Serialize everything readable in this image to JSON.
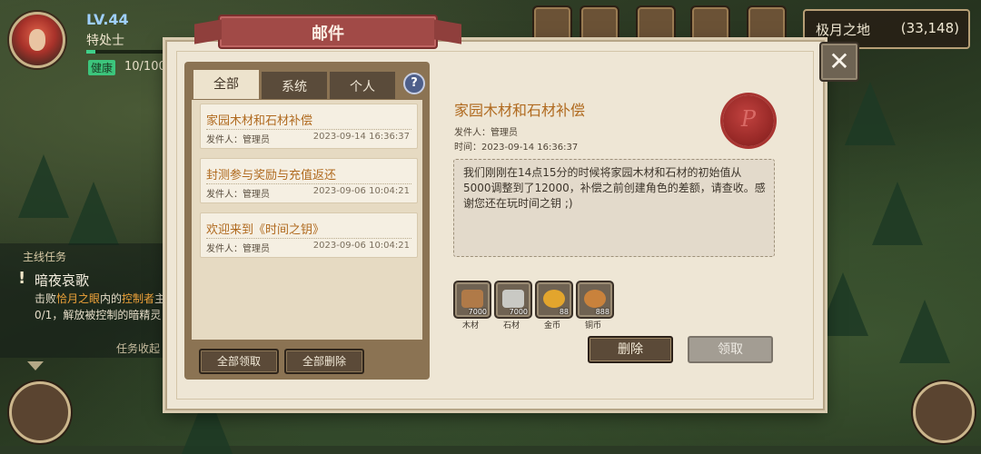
{
  "hud": {
    "level": "LV.44",
    "rank": "特处士",
    "health_label": "健康",
    "health_value": "10/100",
    "health_fraction": 0.1,
    "location_name": "极月之地",
    "location_coords": "(33,148)"
  },
  "quest": {
    "section_title": "主线任务",
    "name": "暗夜哀歌",
    "desc_pre": "击败",
    "desc_hl1": "恰月之眼",
    "desc_mid": "内的",
    "desc_hl2": "控制者",
    "desc_post": "主0/1，解放被控制的暗精灵",
    "collapse_label": "任务收起"
  },
  "dialog": {
    "title": "邮件",
    "close_glyph": "✕",
    "tabs": [
      "全部",
      "系统",
      "个人"
    ],
    "help_glyph": "?",
    "mails": [
      {
        "subject": "家园木材和石材补偿",
        "from": "发件人：管理员",
        "date": "2023-09-14 16:36:37"
      },
      {
        "subject": "封测参与奖励与充值返还",
        "from": "发件人：管理员",
        "date": "2023-09-06 10:04:21"
      },
      {
        "subject": "欢迎来到《时间之钥》",
        "from": "发件人：管理员",
        "date": "2023-09-06 10:04:21"
      }
    ],
    "claim_all_label": "全部领取",
    "delete_all_label": "全部删除"
  },
  "detail": {
    "title": "家园木材和石材补偿",
    "from": "发件人：管理员",
    "time": "时间：2023-09-14 16:36:37",
    "seal_letter": "P",
    "body": "我们刚刚在14点15分的时候将家园木材和石材的初始值从5000调整到了12000，补偿之前创建角色的差额，请查收。感谢您还在玩时间之钥 ;)",
    "rewards": [
      {
        "name": "木材",
        "qty": "7000",
        "icon": "wood-icon",
        "color": "#b07a48"
      },
      {
        "name": "石材",
        "qty": "7000",
        "icon": "stone-icon",
        "color": "#c9c9c4"
      },
      {
        "name": "金币",
        "qty": "88",
        "icon": "gold-coin-icon",
        "color": "#e3a52d"
      },
      {
        "name": "铜币",
        "qty": "888",
        "icon": "copper-coin-icon",
        "color": "#c9823c"
      }
    ],
    "delete_label": "删除",
    "claim_label": "领取"
  }
}
